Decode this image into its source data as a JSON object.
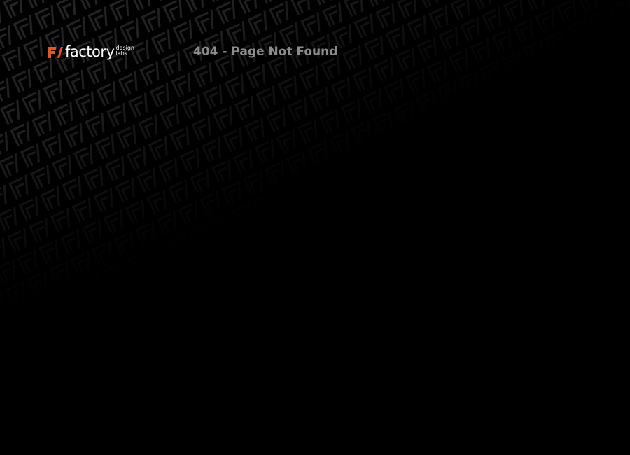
{
  "brand": {
    "name": "factory",
    "sub_line_1": "design",
    "sub_line_2": "labs",
    "accent_color": "#e8561c"
  },
  "page": {
    "title": "404 - Page Not Found",
    "background_color": "#000000"
  }
}
